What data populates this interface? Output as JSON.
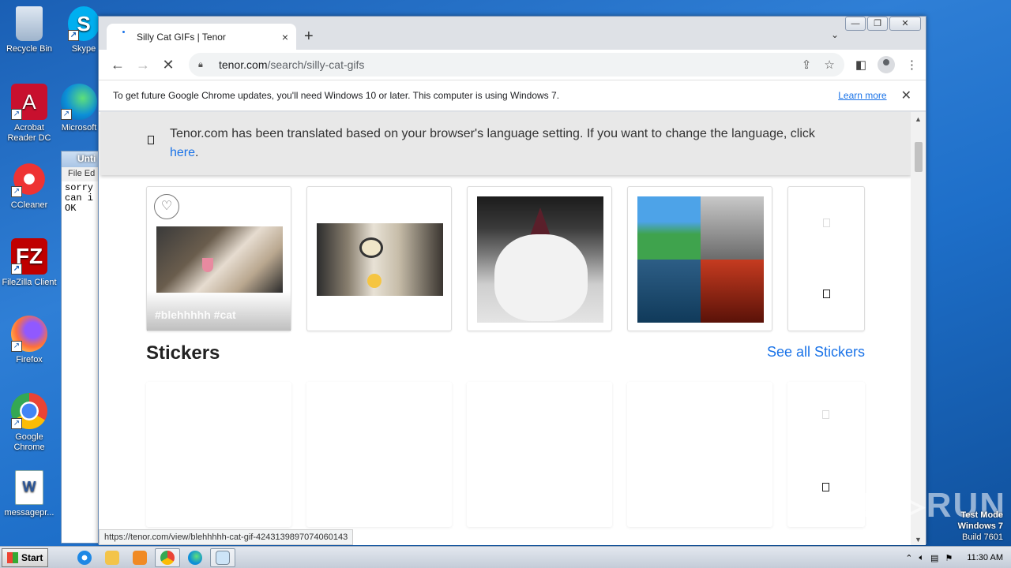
{
  "desktop": {
    "icons": [
      {
        "label": "Recycle Bin",
        "icon": "recycle-bin-icon"
      },
      {
        "label": "Acrobat Reader DC",
        "icon": "acrobat-icon"
      },
      {
        "label": "CCleaner",
        "icon": "ccleaner-icon"
      },
      {
        "label": "FileZilla Client",
        "icon": "filezilla-icon"
      },
      {
        "label": "Firefox",
        "icon": "firefox-icon"
      },
      {
        "label": "Google Chrome",
        "icon": "chrome-icon"
      },
      {
        "label": "messagepr...",
        "icon": "word-doc-icon"
      },
      {
        "label": "Skype",
        "icon": "skype-icon"
      },
      {
        "label": "Microsoft",
        "icon": "edge-icon"
      }
    ],
    "watermark": {
      "line1": "Test Mode",
      "line2": "Windows 7",
      "line3": "Build 7601"
    },
    "brand": "ANY RUN"
  },
  "notepad": {
    "title": "Unti",
    "menu": "File  Ed",
    "lines": [
      "sorry",
      "can i",
      "OK"
    ]
  },
  "browser": {
    "tab": {
      "title": "Silly Cat GIFs | Tenor",
      "close": "×"
    },
    "new_tab": "+",
    "window_buttons": {
      "min": "—",
      "max": "❐",
      "close": "✕"
    },
    "url_host": "tenor.com",
    "url_path": "/search/silly-cat-gifs",
    "infobar": {
      "message": "To get future Google Chrome updates, you'll need Windows 10 or later. This computer is using Windows 7.",
      "link": "Learn more",
      "close": "✕"
    },
    "status_url": "https://tenor.com/view/blehhhhh-cat-gif-4243139897074060143"
  },
  "page": {
    "translate_banner": {
      "text": "Tenor.com has been translated based on your browser's language setting. If you want to change the language, click",
      "link": "here",
      "suffix": "."
    },
    "gif_cards": [
      {
        "tags": "#blehhhhh  #cat",
        "name": "cat-blep"
      },
      {
        "tags": "",
        "name": "cat-wide-eyes"
      },
      {
        "tags": "",
        "name": "cat-party-hat"
      },
      {
        "tags": "",
        "name": "cat-windows-xp"
      }
    ],
    "stickers_heading": "Stickers",
    "see_all_stickers": "See all Stickers"
  },
  "taskbar": {
    "start": "Start",
    "time": "11:30 AM"
  }
}
